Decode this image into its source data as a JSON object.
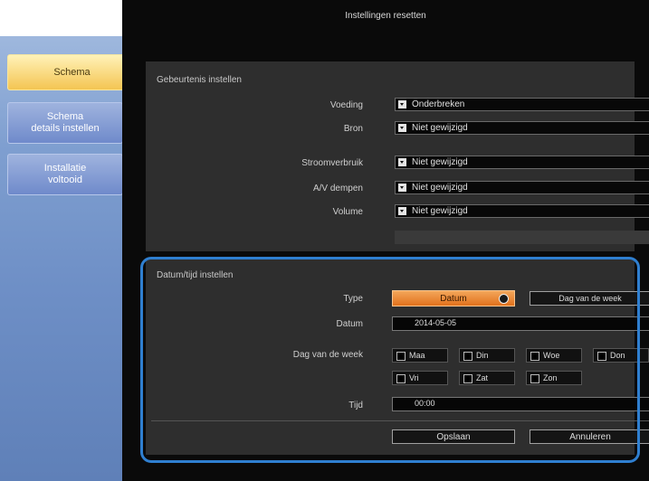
{
  "window": {
    "title": "Instellingen resetten"
  },
  "sidebar": {
    "tabs": [
      {
        "label": "Schema",
        "active": true
      },
      {
        "label": "Schema\ndetails instellen",
        "active": false
      },
      {
        "label": "Installatie\nvoltooid",
        "active": false
      }
    ]
  },
  "event_settings": {
    "section_title": "Gebeurtenis instellen",
    "rows": [
      {
        "label": "Voeding",
        "value": "Onderbreken"
      },
      {
        "label": "Bron",
        "value": "Niet gewijzigd"
      },
      {
        "label": "Stroomverbruik",
        "value": "Niet gewijzigd"
      },
      {
        "label": "A/V dempen",
        "value": "Niet gewijzigd"
      },
      {
        "label": "Volume",
        "value": "Niet gewijzigd"
      }
    ]
  },
  "datetime_settings": {
    "section_title": "Datum/tijd instellen",
    "type_label": "Type",
    "type_options": [
      "Datum",
      "Dag van de week"
    ],
    "date_label": "Datum",
    "date_value": "2014-05-05",
    "weekday_label": "Dag van de week",
    "weekdays": [
      "Maa",
      "Din",
      "Woe",
      "Don",
      "Vri",
      "Zat",
      "Zon"
    ],
    "time_label": "Tijd",
    "time_value": "00:00"
  },
  "actions": {
    "save": "Opslaan",
    "cancel": "Annuleren"
  }
}
